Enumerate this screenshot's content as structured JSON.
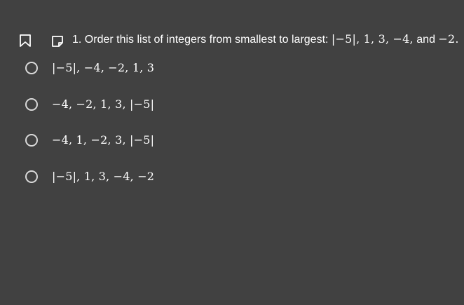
{
  "question": {
    "prefix": "1. Order this list of integers from smallest to largest: ",
    "list": "|−5|,  1,  3, −4,",
    "connector": " and ",
    "last": "−2."
  },
  "options": [
    {
      "label": "|−5|, −4, −2,  1,  3"
    },
    {
      "label": "−4, −2,  1,  3, |−5|"
    },
    {
      "label": "−4,  1, −2,  3, |−5|"
    },
    {
      "label": "|−5|,  1,  3, −4, −2"
    }
  ],
  "icons": {
    "bookmark": "bookmark-icon",
    "note": "note-icon"
  },
  "colors": {
    "background": "#414141",
    "text": "#ffffff",
    "radio_border": "#d9d9d9"
  }
}
